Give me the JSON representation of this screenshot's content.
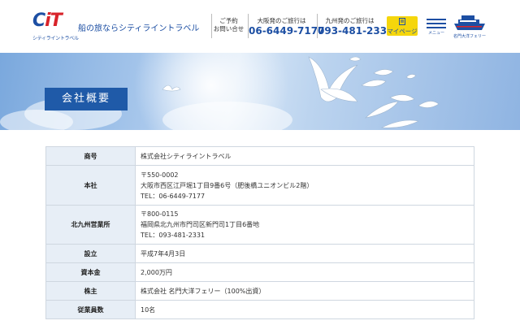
{
  "header": {
    "logo_text_c": "C",
    "logo_text_it": "iT",
    "logo_sub": "シティライントラベル",
    "tagline": "船の旅ならシティライントラベル",
    "contact_line1": "ご予約",
    "contact_line2": "お問い合せ",
    "osaka_caption": "大阪発のご旅行は",
    "osaka_phone": "06-6449-7177",
    "kyushu_caption": "九州発のご旅行は",
    "kyushu_phone": "093-481-2331",
    "mypage_label": "マイページ",
    "menu_label": "メニュー",
    "ferry_label": "名門大洋フェリー"
  },
  "hero": {
    "title": "会社概要"
  },
  "company": {
    "rows": [
      {
        "label": "商号",
        "lines": [
          "株式会社シティライントラベル"
        ]
      },
      {
        "label": "本社",
        "lines": [
          "〒550-0002",
          "大阪市西区江戸堀1丁目9番6号（肥後橋ユニオンビル2階）",
          "TEL：06-6449-7177"
        ]
      },
      {
        "label": "北九州営業所",
        "lines": [
          "〒800-0115",
          "福岡県北九州市門司区新門司1丁目6番地",
          "TEL：093-481-2331"
        ]
      },
      {
        "label": "設立",
        "lines": [
          "平成7年4月3日"
        ]
      },
      {
        "label": "資本金",
        "lines": [
          "2,000万円"
        ]
      },
      {
        "label": "株主",
        "lines": [
          "株式会社 名門大洋フェリー（100%出資）"
        ]
      },
      {
        "label": "従業員数",
        "lines": [
          "10名"
        ]
      }
    ]
  },
  "colors": {
    "brand_blue": "#1d4fa3",
    "brand_red": "#d8232a",
    "mypage_yellow": "#f5d60c",
    "title_bg": "#1f5aa8",
    "label_bg": "#e7eef6"
  }
}
